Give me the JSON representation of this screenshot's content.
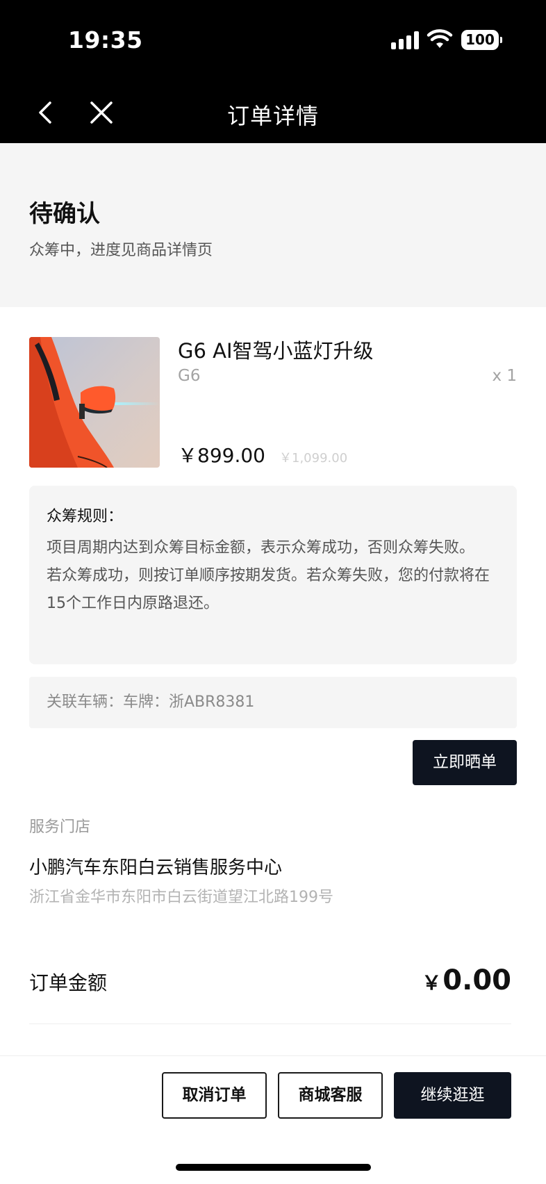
{
  "status_bar": {
    "time": "19:35",
    "battery": "100"
  },
  "nav": {
    "title": "订单详情"
  },
  "order_status": {
    "title": "待确认",
    "subtitle": "众筹中，进度见商品详情页"
  },
  "product": {
    "name": "G6 AI智驾小蓝灯升级",
    "model": "G6",
    "quantity": "x 1",
    "price": "￥899.00",
    "original_price": "￥1,099.00"
  },
  "rules": {
    "title": "众筹规则：",
    "line1": "项目周期内达到众筹目标金额，表示众筹成功，否则众筹失败。",
    "line2": "若众筹成功，则按订单顺序按期发货。若众筹失败，您的付款将在15个工作日内原路退还。"
  },
  "vehicle": {
    "text": "关联车辆：车牌：浙ABR8381"
  },
  "share_button": "立即晒单",
  "store": {
    "label": "服务门店",
    "name": "小鹏汽车东阳白云销售服务中心",
    "address": "浙江省金华市东阳市白云街道望江北路199号"
  },
  "amount": {
    "label": "订单金额",
    "currency": "￥",
    "value": "0.00"
  },
  "actions": {
    "cancel": "取消订单",
    "service": "商城客服",
    "continue": "继续逛逛"
  }
}
